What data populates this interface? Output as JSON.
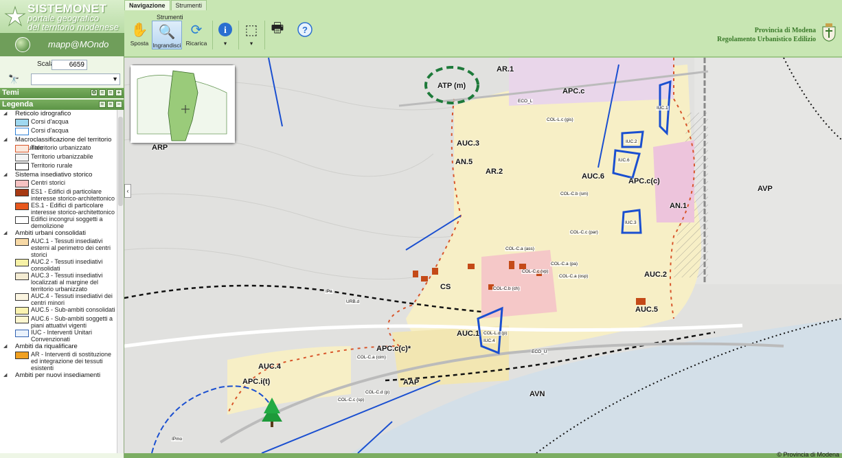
{
  "brand": {
    "title": "SISTEMONET",
    "subtitle1": "portale geografico",
    "subtitle2": "del territorio modenese",
    "app_name": "mapp@MOndo"
  },
  "scale": {
    "label": "Scala",
    "value": "6659"
  },
  "panels": {
    "temi": "Temi",
    "legenda": "Legenda"
  },
  "tabs": [
    "Navigazione",
    "Strumenti"
  ],
  "tools_group_label": "Strumenti",
  "tools": {
    "sposta": "Sposta",
    "ingrandisci": "Ingrandisci",
    "ricarica": "Ricarica"
  },
  "provincia": {
    "line1": "Provincia di Modena",
    "line2": "Regolamento Urbanistico Edilizio"
  },
  "legend": [
    {
      "type": "h",
      "text": "Reticolo idrografico"
    },
    {
      "type": "i",
      "text": "Corsi d'acqua",
      "fill": "#9fd8f0"
    },
    {
      "type": "i",
      "text": "Corsi d'acqua",
      "fill": "#ffffff",
      "border": "#2d7fd5"
    },
    {
      "type": "h",
      "text": "Macroclassificazione del territorio comunale"
    },
    {
      "type": "i",
      "text": "Tterritorio urbanizzato",
      "fill": "#fbe8dc",
      "border": "#d8552a"
    },
    {
      "type": "i",
      "text": "Territorio urbanizzabile",
      "fill": "#f4f4f4",
      "border": "#555"
    },
    {
      "type": "i",
      "text": "Territorio rurale",
      "fill": "#ffffff",
      "border": "#111"
    },
    {
      "type": "h",
      "text": "Sistema insediativo storico"
    },
    {
      "type": "i",
      "text": "Centri storici",
      "fill": "#f6c2c2"
    },
    {
      "type": "i",
      "text": "ES1 - Edifici di particolare interesse storico-architettonico",
      "fill": "#a83a14"
    },
    {
      "type": "i",
      "text": "ES.1 - Edifici di particolare interesse storico-architettonico",
      "fill": "#e8581e"
    },
    {
      "type": "i",
      "text": "Edifici incongrui soggetti a demolizione",
      "fill": "#ffffff"
    },
    {
      "type": "h",
      "text": "Ambiti urbani consolidati"
    },
    {
      "type": "i",
      "text": "AUC.1 - Tessuti insediativi esterni al perimetro dei centri storici",
      "fill": "#f7d9a6"
    },
    {
      "type": "i",
      "text": "AUC.2 - Tessuti insediativi consolidati",
      "fill": "#f6f1a6"
    },
    {
      "type": "i",
      "text": "AUC.3 - Tessuti insediativi localizzati al margine del territorio urbanizzato",
      "fill": "#f4ecd3"
    },
    {
      "type": "i",
      "text": "AUC.4 - Tessuti insediativi dei centri minori",
      "fill": "#fbf5e1"
    },
    {
      "type": "i",
      "text": "AUC.5 - Sub-ambiti consolidati",
      "fill": "#fbf3b0"
    },
    {
      "type": "i",
      "text": "AUC.6 - Sub-ambiti soggetti a piani attuativi vigenti",
      "fill": "#fdf6cf"
    },
    {
      "type": "i",
      "text": "IUC - Interventi Unitari Convenzionati",
      "fill": "#eaf2fb",
      "border": "#3060b0"
    },
    {
      "type": "h",
      "text": "Ambiti da riqualificare"
    },
    {
      "type": "i",
      "text": "AR - Interventi di sostituzione ed integrazione dei tessuti esistenti",
      "fill": "#f0a020"
    },
    {
      "type": "h",
      "text": "Ambiti per nuovi insediamenti"
    }
  ],
  "map_labels": {
    "ar1": "AR.1",
    "atp": "ATP (m)",
    "apcc": "APC.c",
    "arp": "ARP",
    "auc3": "AUC.3",
    "an5": "AN.5",
    "ar2": "AR.2",
    "auc6": "AUC.6",
    "apccc": "APC.c(c)",
    "avp": "AVP",
    "an1": "AN.1",
    "auc2": "AUC.2",
    "cs": "CS",
    "auc5": "AUC.5",
    "auc1": "AUC.1",
    "apccc2": "APC.c(c)*",
    "auc4": "AUC.4",
    "apci": "APC.i(t)",
    "aap": "AAP",
    "avn": "AVN"
  },
  "map_small": {
    "iuc1": "IUC.1",
    "iuc2": "IUC.2",
    "iuc6": "IUC.6",
    "iuc3": "IUC.3",
    "iuc4": "IUC.4",
    "col_l": "ECO_L",
    "colg": "COL-L.c (gis)",
    "colsm": "COL-C.b (sm)",
    "colpar": "COL-C.c (par)",
    "colass": "COL-C.a (ass)",
    "colpa": "COL-C.a (pa)",
    "colvp": "COL-C.c (vp)",
    "colosp": "COL-C.a (osp)",
    "colch": "COL-C.b (ch)",
    "colcim": "COL-C.a (cim)",
    "coldp": "COL-L.d (p)",
    "ecou": "ECO_U",
    "colsp": "COL-C.c (sp)",
    "colcdp": "COL-C.d (p)",
    "ipa": "IPa",
    "urbd": "URB.d",
    "ipmo": "IPmo"
  },
  "footer": "© Provincia di Modena"
}
